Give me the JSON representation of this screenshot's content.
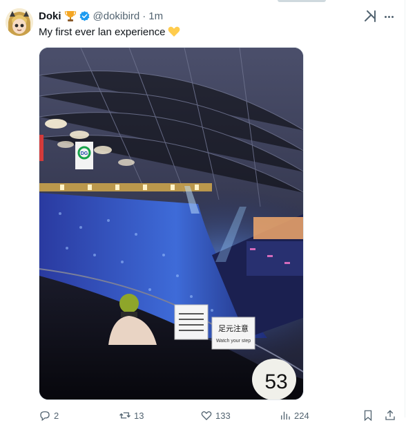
{
  "author": {
    "display_name": "Doki",
    "handle": "@dokibird",
    "separator": "·",
    "time": "1m"
  },
  "tweet": {
    "text": "My first ever lan experience"
  },
  "photo": {
    "sign_left_text": "足元注意",
    "sign_left_sub": "Watch your step",
    "sign_number": "53",
    "emblem": "DG"
  },
  "actions": {
    "replies": "2",
    "reposts": "13",
    "likes": "133",
    "views": "224"
  },
  "icons": {
    "trophy": "trophy-emoji-icon",
    "verified": "verified-badge-icon",
    "heart": "yellow-heart-emoji-icon",
    "grok": "grok-icon",
    "more": "more-icon",
    "reply": "reply-icon",
    "repost": "repost-icon",
    "like": "like-icon",
    "views": "views-icon",
    "bookmark": "bookmark-icon",
    "share": "share-icon"
  },
  "colors": {
    "verified": "#1d9bf0",
    "secondary_text": "#536471",
    "heart": "#ffcc4d"
  }
}
